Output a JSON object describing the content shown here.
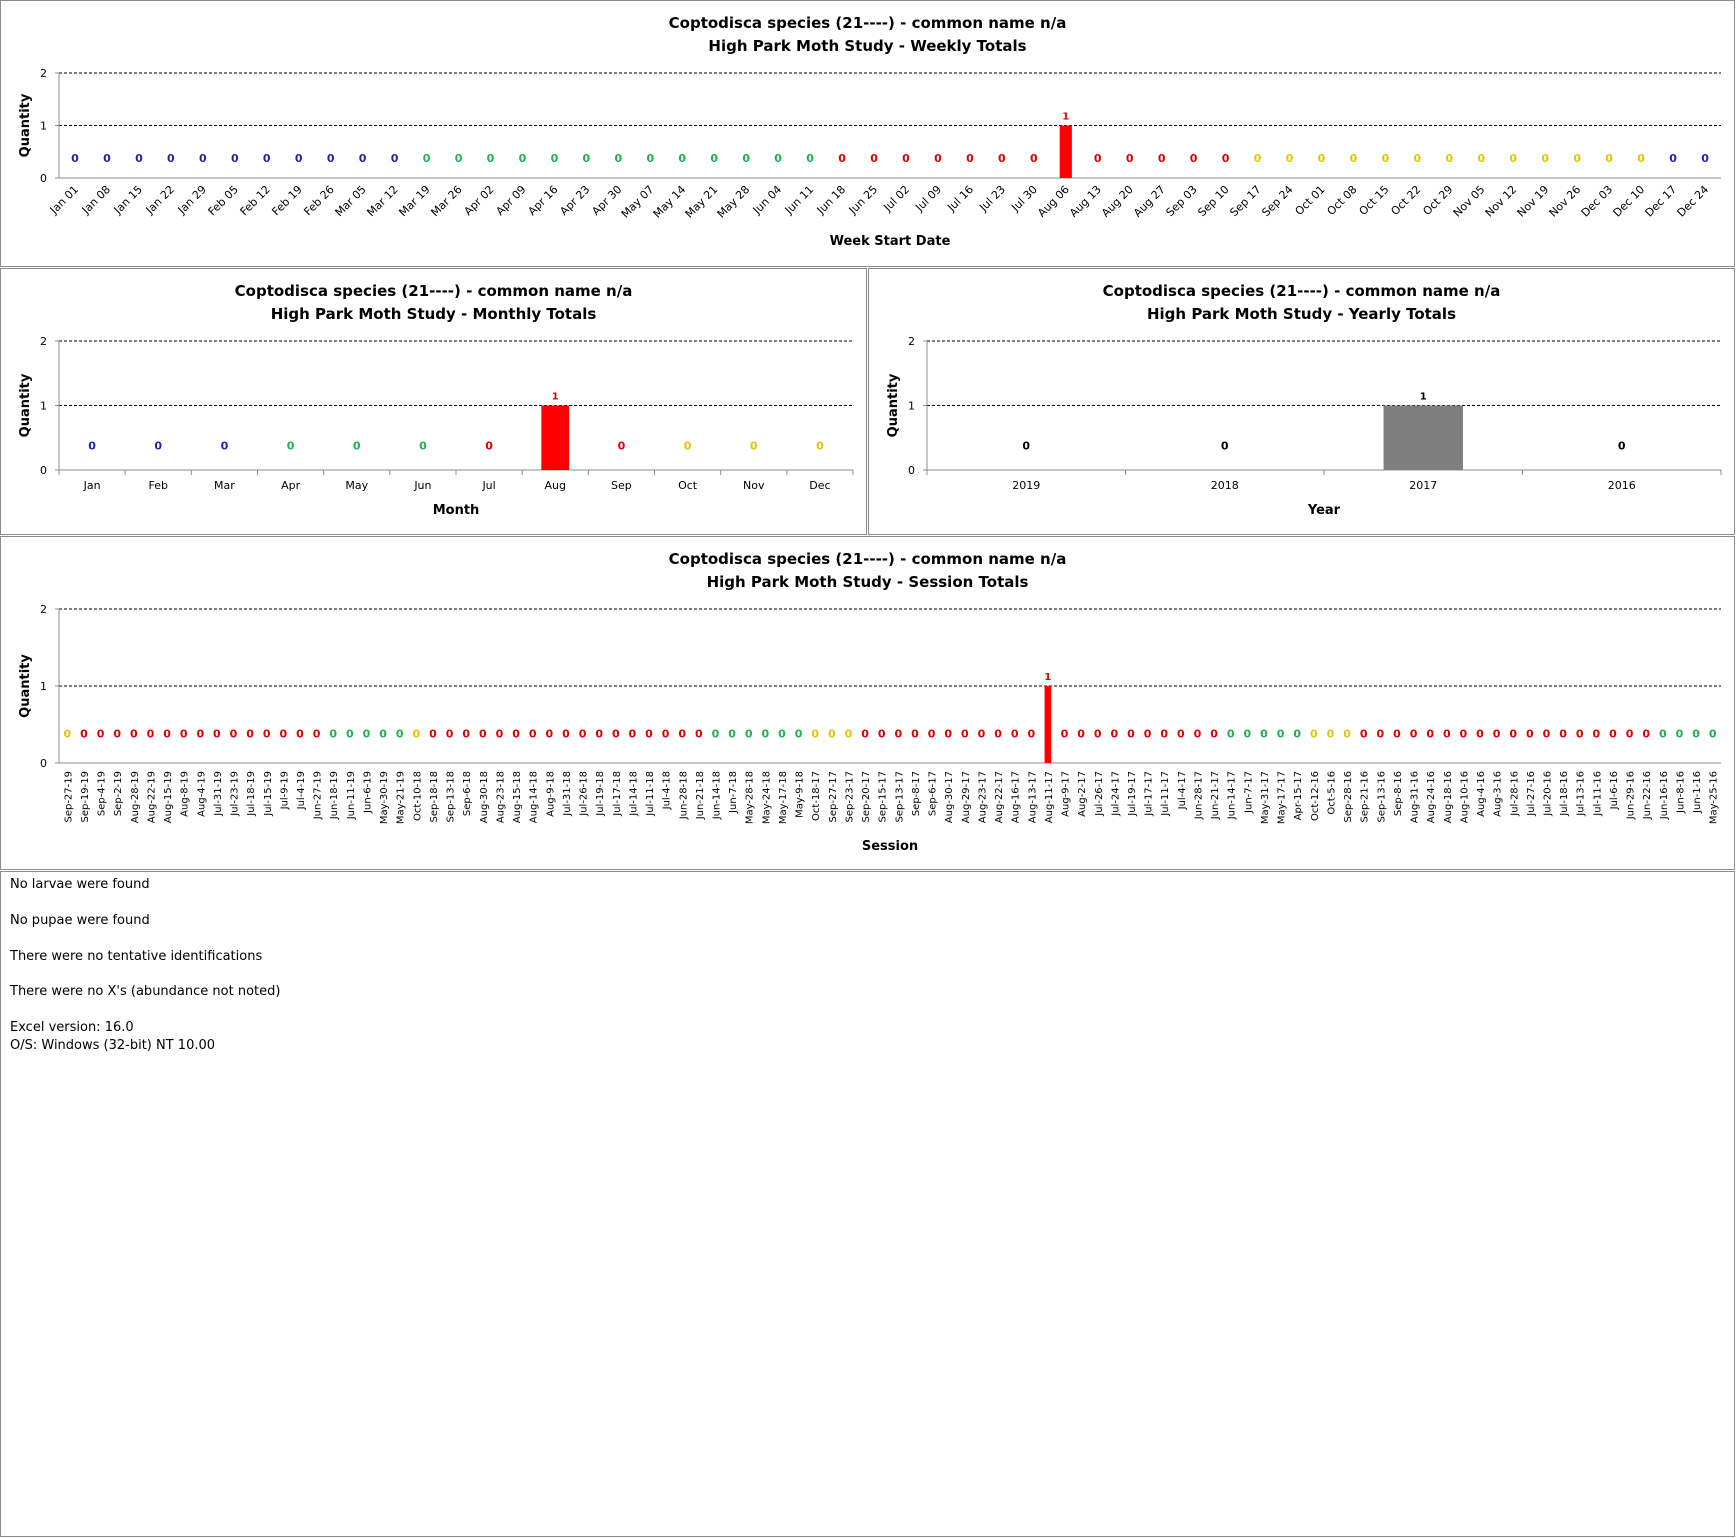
{
  "colors": {
    "blue": "#1f1fbf",
    "green": "#22b14c",
    "red": "#e00000",
    "yellow": "#e8c400",
    "gray": "#7f7f7f",
    "bar_red": "#ff0000"
  },
  "notes": {
    "larvae": "No larvae were found",
    "pupae": "No pupae were found",
    "tentative": "There were no tentative identifications",
    "x_abundance": "There were no X's (abundance not noted)",
    "excel_version": "Excel version: 16.0",
    "os": "O/S: Windows (32-bit) NT 10.00"
  },
  "chart_data": [
    {
      "id": "weekly",
      "type": "bar",
      "title": "Coptodisca species (21----)  - common name n/a",
      "subtitle": "High Park Moth Study  -  Weekly Totals",
      "xlabel": "Week Start Date",
      "ylabel": "Quantity",
      "ylim": [
        0,
        2
      ],
      "yticks": [
        0,
        1,
        2
      ],
      "grid": true,
      "categories": [
        "Jan 01",
        "Jan 08",
        "Jan 15",
        "Jan 22",
        "Jan 29",
        "Feb 05",
        "Feb 12",
        "Feb 19",
        "Feb 26",
        "Mar 05",
        "Mar 12",
        "Mar 19",
        "Mar 26",
        "Apr 02",
        "Apr 09",
        "Apr 16",
        "Apr 23",
        "Apr 30",
        "May 07",
        "May 14",
        "May 21",
        "May 28",
        "Jun 04",
        "Jun 11",
        "Jun 18",
        "Jun 25",
        "Jul 02",
        "Jul 09",
        "Jul 16",
        "Jul 23",
        "Jul 30",
        "Aug 06",
        "Aug 13",
        "Aug 20",
        "Aug 27",
        "Sep 03",
        "Sep 10",
        "Sep 17",
        "Sep 24",
        "Oct 01",
        "Oct 08",
        "Oct 15",
        "Oct 22",
        "Oct 29",
        "Nov 05",
        "Nov 12",
        "Nov 19",
        "Nov 26",
        "Dec 03",
        "Dec 10",
        "Dec 17",
        "Dec 24"
      ],
      "values": [
        0,
        0,
        0,
        0,
        0,
        0,
        0,
        0,
        0,
        0,
        0,
        0,
        0,
        0,
        0,
        0,
        0,
        0,
        0,
        0,
        0,
        0,
        0,
        0,
        0,
        0,
        0,
        0,
        0,
        0,
        0,
        1,
        0,
        0,
        0,
        0,
        0,
        0,
        0,
        0,
        0,
        0,
        0,
        0,
        0,
        0,
        0,
        0,
        0,
        0,
        0,
        0
      ],
      "label_colors": [
        "blue",
        "blue",
        "blue",
        "blue",
        "blue",
        "blue",
        "blue",
        "blue",
        "blue",
        "blue",
        "blue",
        "green",
        "green",
        "green",
        "green",
        "green",
        "green",
        "green",
        "green",
        "green",
        "green",
        "green",
        "green",
        "green",
        "red",
        "red",
        "red",
        "red",
        "red",
        "red",
        "red",
        "red",
        "red",
        "red",
        "red",
        "red",
        "red",
        "yellow",
        "yellow",
        "yellow",
        "yellow",
        "yellow",
        "yellow",
        "yellow",
        "yellow",
        "yellow",
        "yellow",
        "yellow",
        "yellow",
        "yellow",
        "blue",
        "blue"
      ],
      "bar_color": "bar_red",
      "rotate_labels": -45
    },
    {
      "id": "monthly",
      "type": "bar",
      "title": "Coptodisca species (21----)  - common name n/a",
      "subtitle": "High Park Moth Study  -  Monthly Totals",
      "xlabel": "Month",
      "ylabel": "Quantity",
      "ylim": [
        0,
        2
      ],
      "yticks": [
        0,
        1,
        2
      ],
      "grid": true,
      "categories": [
        "Jan",
        "Feb",
        "Mar",
        "Apr",
        "May",
        "Jun",
        "Jul",
        "Aug",
        "Sep",
        "Oct",
        "Nov",
        "Dec"
      ],
      "values": [
        0,
        0,
        0,
        0,
        0,
        0,
        0,
        1,
        0,
        0,
        0,
        0
      ],
      "label_colors": [
        "blue",
        "blue",
        "blue",
        "green",
        "green",
        "green",
        "red",
        "red",
        "red",
        "yellow",
        "yellow",
        "yellow"
      ],
      "bar_color": "bar_red",
      "rotate_labels": 0
    },
    {
      "id": "yearly",
      "type": "bar",
      "title": "Coptodisca species (21----)  - common name n/a",
      "subtitle": "High Park Moth Study  -  Yearly Totals",
      "xlabel": "Year",
      "ylabel": "Quantity",
      "ylim": [
        0,
        2
      ],
      "yticks": [
        0,
        1,
        2
      ],
      "grid": true,
      "categories": [
        "2019",
        "2018",
        "2017",
        "2016"
      ],
      "values": [
        0,
        0,
        1,
        0
      ],
      "label_colors": [
        "black",
        "black",
        "black",
        "black"
      ],
      "bar_color": "gray",
      "rotate_labels": 0
    },
    {
      "id": "session",
      "type": "bar",
      "title": "Coptodisca species (21----)  - common name n/a",
      "subtitle": "High Park Moth Study  -  Session Totals",
      "xlabel": "Session",
      "ylabel": "Quantity",
      "ylim": [
        0,
        2
      ],
      "yticks": [
        0,
        1,
        2
      ],
      "grid": true,
      "categories": [
        "Sep-27-19",
        "Sep-19-19",
        "Sep-4-19",
        "Sep-2-19",
        "Aug-28-19",
        "Aug-22-19",
        "Aug-15-19",
        "Aug-8-19",
        "Aug-4-19",
        "Jul-31-19",
        "Jul-23-19",
        "Jul-18-19",
        "Jul-15-19",
        "Jul-9-19",
        "Jul-4-19",
        "Jun-27-19",
        "Jun-18-19",
        "Jun-11-19",
        "Jun-6-19",
        "May-30-19",
        "May-21-19",
        "Oct-10-18",
        "Sep-18-18",
        "Sep-13-18",
        "Sep-6-18",
        "Aug-30-18",
        "Aug-23-18",
        "Aug-15-18",
        "Aug-14-18",
        "Aug-9-18",
        "Jul-31-18",
        "Jul-26-18",
        "Jul-19-18",
        "Jul-17-18",
        "Jul-14-18",
        "Jul-11-18",
        "Jul-4-18",
        "Jun-28-18",
        "Jun-21-18",
        "Jun-14-18",
        "Jun-7-18",
        "May-28-18",
        "May-24-18",
        "May-17-18",
        "May-9-18",
        "Oct-18-17",
        "Sep-27-17",
        "Sep-23-17",
        "Sep-20-17",
        "Sep-15-17",
        "Sep-13-17",
        "Sep-8-17",
        "Sep-6-17",
        "Aug-30-17",
        "Aug-29-17",
        "Aug-23-17",
        "Aug-22-17",
        "Aug-16-17",
        "Aug-13-17",
        "Aug-11-17",
        "Aug-9-17",
        "Aug-2-17",
        "Jul-26-17",
        "Jul-24-17",
        "Jul-19-17",
        "Jul-17-17",
        "Jul-11-17",
        "Jul-4-17",
        "Jun-28-17",
        "Jun-21-17",
        "Jun-14-17",
        "Jun-7-17",
        "May-31-17",
        "May-17-17",
        "Apr-15-17",
        "Oct-12-16",
        "Oct-5-16",
        "Sep-28-16",
        "Sep-21-16",
        "Sep-13-16",
        "Sep-8-16",
        "Aug-31-16",
        "Aug-24-16",
        "Aug-18-16",
        "Aug-10-16",
        "Aug-4-16",
        "Aug-3-16",
        "Jul-28-16",
        "Jul-27-16",
        "Jul-20-16",
        "Jul-18-16",
        "Jul-13-16",
        "Jul-11-16",
        "Jul-6-16",
        "Jun-29-16",
        "Jun-22-16",
        "Jun-16-16",
        "Jun-8-16",
        "Jun-1-16",
        "May-25-16"
      ],
      "values": [
        0,
        0,
        0,
        0,
        0,
        0,
        0,
        0,
        0,
        0,
        0,
        0,
        0,
        0,
        0,
        0,
        0,
        0,
        0,
        0,
        0,
        0,
        0,
        0,
        0,
        0,
        0,
        0,
        0,
        0,
        0,
        0,
        0,
        0,
        0,
        0,
        0,
        0,
        0,
        0,
        0,
        0,
        0,
        0,
        0,
        0,
        0,
        0,
        0,
        0,
        0,
        0,
        0,
        0,
        0,
        0,
        0,
        0,
        0,
        1,
        0,
        0,
        0,
        0,
        0,
        0,
        0,
        0,
        0,
        0,
        0,
        0,
        0,
        0,
        0,
        0,
        0,
        0,
        0,
        0,
        0,
        0,
        0,
        0,
        0,
        0,
        0,
        0,
        0,
        0,
        0,
        0,
        0,
        0,
        0,
        0,
        0,
        0,
        0,
        0
      ],
      "label_colors": [
        "yellow",
        "red",
        "red",
        "red",
        "red",
        "red",
        "red",
        "red",
        "red",
        "red",
        "red",
        "red",
        "red",
        "red",
        "red",
        "red",
        "green",
        "green",
        "green",
        "green",
        "green",
        "yellow",
        "red",
        "red",
        "red",
        "red",
        "red",
        "red",
        "red",
        "red",
        "red",
        "red",
        "red",
        "red",
        "red",
        "red",
        "red",
        "red",
        "red",
        "green",
        "green",
        "green",
        "green",
        "green",
        "green",
        "yellow",
        "yellow",
        "yellow",
        "red",
        "red",
        "red",
        "red",
        "red",
        "red",
        "red",
        "red",
        "red",
        "red",
        "red",
        "red",
        "red",
        "red",
        "red",
        "red",
        "red",
        "red",
        "red",
        "red",
        "red",
        "red",
        "green",
        "green",
        "green",
        "green",
        "green",
        "yellow",
        "yellow",
        "yellow",
        "red",
        "red",
        "red",
        "red",
        "red",
        "red",
        "red",
        "red",
        "red",
        "red",
        "red",
        "red",
        "red",
        "red",
        "red",
        "red",
        "red",
        "red",
        "green",
        "green",
        "green",
        "green"
      ],
      "bar_color": "bar_red",
      "rotate_labels": -90
    }
  ]
}
